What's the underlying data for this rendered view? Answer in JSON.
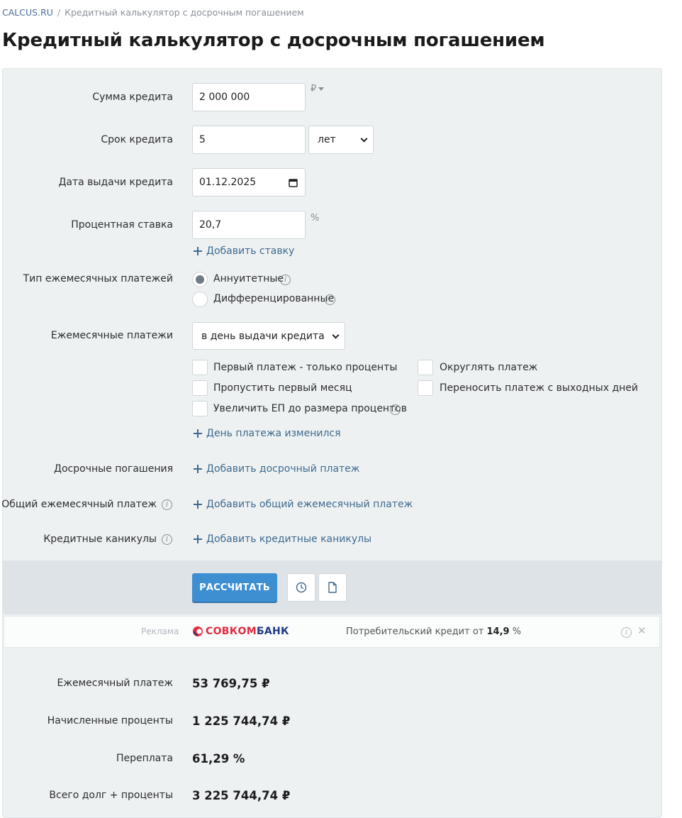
{
  "breadcrumb": {
    "home": "CALCUS.RU",
    "separator": "/",
    "current": "Кредитный калькулятор с досрочным погашением"
  },
  "page_title": "Кредитный калькулятор с досрочным погашением",
  "form": {
    "amount": {
      "label": "Сумма кредита",
      "value": "2 000 000",
      "currency": "₽"
    },
    "term": {
      "label": "Срок кредита",
      "value": "5",
      "unit_selected": "лет"
    },
    "issue_date": {
      "label": "Дата выдачи кредита",
      "value": "01.12.2025"
    },
    "rate": {
      "label": "Процентная ставка",
      "value": "20,7",
      "unit": "%",
      "add_rate_link": "Добавить ставку"
    },
    "payment_type": {
      "label": "Тип ежемесячных платежей",
      "options": [
        {
          "label": "Аннуитетные",
          "checked": true
        },
        {
          "label": "Дифференцированные",
          "checked": false
        }
      ]
    },
    "monthly_payments": {
      "label": "Ежемесячные платежи",
      "selected": "в день выдачи кредита",
      "checkboxes": {
        "first_interest_only": "Первый платеж - только проценты",
        "skip_first_month": "Пропустить первый месяц",
        "increase_payment": "Увеличить ЕП до размера процентов",
        "round_payment": "Округлять платеж",
        "move_weekend": "Переносить платеж с выходных дней"
      },
      "day_changed_link": "День платежа изменился"
    },
    "early_repayments": {
      "label": "Досрочные погашения",
      "link": "Добавить досрочный платеж"
    },
    "common_payment": {
      "label": "Общий ежемесячный платеж",
      "link": "Добавить общий ежемесячный платеж"
    },
    "holidays": {
      "label": "Кредитные каникулы",
      "link": "Добавить кредитные каникулы"
    }
  },
  "actions": {
    "calculate": "РАССЧИТАТЬ",
    "history_icon": "clock-icon",
    "document_icon": "document-icon"
  },
  "ad": {
    "label": "Реклама",
    "brand_part1": "СОВКОМ",
    "brand_part2": "БАНК",
    "text": "Потребительский кредит от",
    "rate": "14,9",
    "rate_unit": "%",
    "brand_colors": {
      "red": "#e32b3f",
      "blue": "#1f3a82"
    }
  },
  "results": {
    "monthly_payment": {
      "label": "Ежемесячный платеж",
      "value": "53 769,75 ₽"
    },
    "interest": {
      "label": "Начисленные проценты",
      "value": "1 225 744,74 ₽"
    },
    "overpayment": {
      "label": "Переплата",
      "value": "61,29 %"
    },
    "total": {
      "label": "Всего долг + проценты",
      "value": "3 225 744,74 ₽"
    }
  },
  "colors": {
    "accent": "#3d8fd1",
    "link": "#3f6a8e",
    "panel_bg": "#edf1f2"
  }
}
